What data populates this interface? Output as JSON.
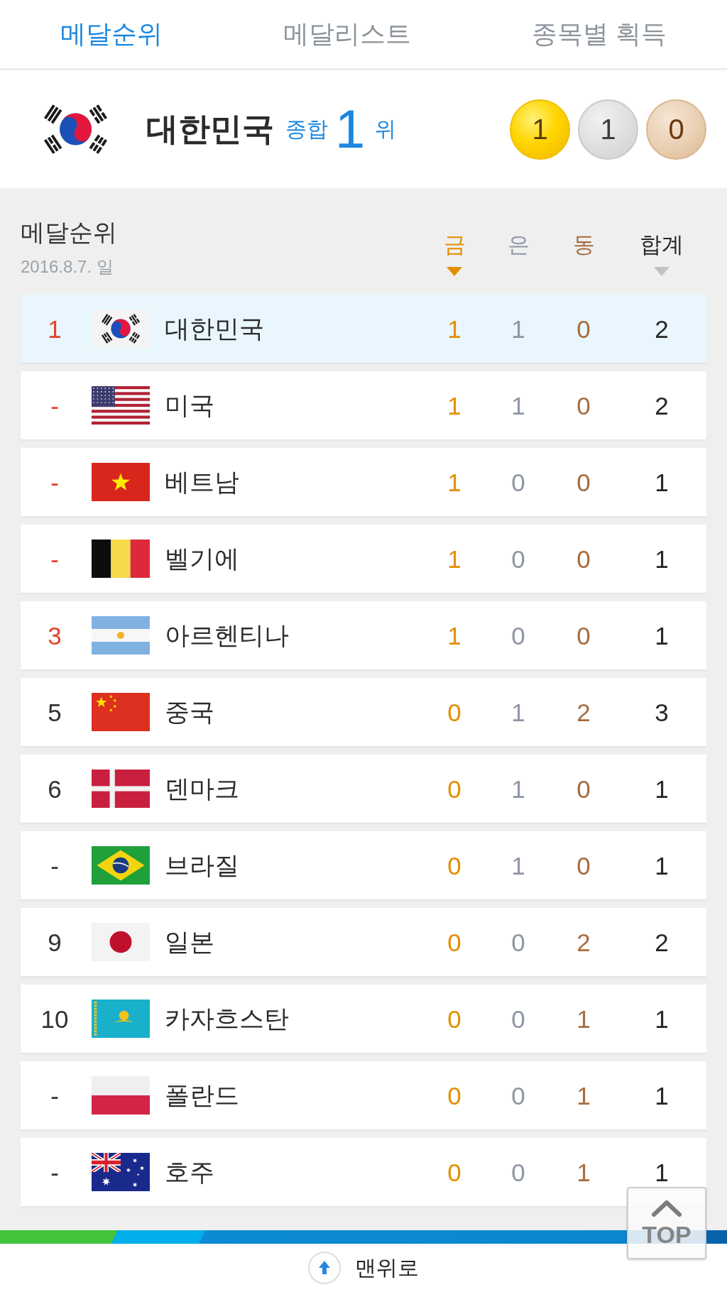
{
  "tabs": [
    {
      "label": "메달순위",
      "selected": true
    },
    {
      "label": "메달리스트",
      "selected": false
    },
    {
      "label": "종목별 획득",
      "selected": false
    }
  ],
  "my_country": {
    "kind": "korea",
    "name": "대한민국",
    "overall_label": "종합",
    "rank": "1",
    "rank_suffix": "위",
    "medals": [
      {
        "kind": "gold",
        "count": "1"
      },
      {
        "kind": "silver",
        "count": "1"
      },
      {
        "kind": "bronze",
        "count": "0"
      }
    ]
  },
  "standings": {
    "title": "메달순위",
    "date": "2016.8.7. 일",
    "columns": [
      {
        "label": "금",
        "kind": "gold",
        "sortable": true,
        "selected": true
      },
      {
        "label": "은",
        "kind": "silver",
        "sortable": false,
        "selected": false
      },
      {
        "label": "동",
        "kind": "bronze",
        "sortable": false,
        "selected": false
      },
      {
        "label": "합계",
        "kind": "total",
        "sortable": true,
        "selected": false
      }
    ],
    "rows": [
      {
        "rank": "1",
        "rank_emphasized": true,
        "kind": "korea",
        "country": "대한민국",
        "counts": [
          "1",
          "1",
          "0",
          "2"
        ],
        "selected": true
      },
      {
        "rank": "-",
        "rank_emphasized": true,
        "kind": "usa",
        "country": "미국",
        "counts": [
          "1",
          "1",
          "0",
          "2"
        ],
        "selected": false
      },
      {
        "rank": "-",
        "rank_emphasized": true,
        "kind": "vietnam",
        "country": "베트남",
        "counts": [
          "1",
          "0",
          "0",
          "1"
        ],
        "selected": false
      },
      {
        "rank": "-",
        "rank_emphasized": true,
        "kind": "belgium",
        "country": "벨기에",
        "counts": [
          "1",
          "0",
          "0",
          "1"
        ],
        "selected": false
      },
      {
        "rank": "3",
        "rank_emphasized": true,
        "kind": "argentina",
        "country": "아르헨티나",
        "counts": [
          "1",
          "0",
          "0",
          "1"
        ],
        "selected": false
      },
      {
        "rank": "5",
        "rank_emphasized": false,
        "kind": "china",
        "country": "중국",
        "counts": [
          "0",
          "1",
          "2",
          "3"
        ],
        "selected": false
      },
      {
        "rank": "6",
        "rank_emphasized": false,
        "kind": "denmark",
        "country": "덴마크",
        "counts": [
          "0",
          "1",
          "0",
          "1"
        ],
        "selected": false
      },
      {
        "rank": "-",
        "rank_emphasized": false,
        "kind": "brazil",
        "country": "브라질",
        "counts": [
          "0",
          "1",
          "0",
          "1"
        ],
        "selected": false
      },
      {
        "rank": "9",
        "rank_emphasized": false,
        "kind": "japan",
        "country": "일본",
        "counts": [
          "0",
          "0",
          "2",
          "2"
        ],
        "selected": false
      },
      {
        "rank": "10",
        "rank_emphasized": false,
        "kind": "kazakhstan",
        "country": "카자흐스탄",
        "counts": [
          "0",
          "0",
          "1",
          "1"
        ],
        "selected": false
      },
      {
        "rank": "-",
        "rank_emphasized": false,
        "kind": "poland",
        "country": "폴란드",
        "counts": [
          "0",
          "0",
          "1",
          "1"
        ],
        "selected": false
      },
      {
        "rank": "-",
        "rank_emphasized": false,
        "kind": "australia",
        "country": "호주",
        "counts": [
          "0",
          "0",
          "1",
          "1"
        ],
        "selected": false
      }
    ]
  },
  "top_button": {
    "label": "TOP"
  },
  "footer": {
    "back_to_top": "맨위로"
  }
}
